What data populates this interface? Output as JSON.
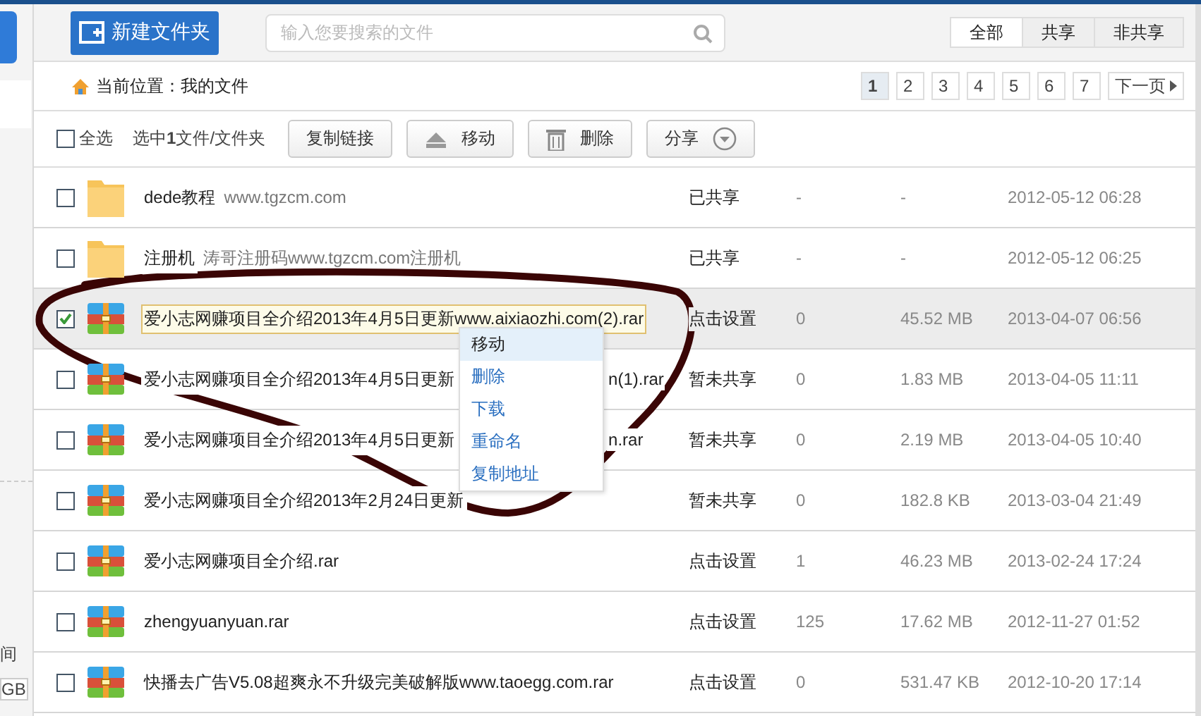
{
  "sidebar": {
    "texts": [
      "间",
      "GB"
    ]
  },
  "toolbar": {
    "new_folder": "新建文件夹",
    "search": {
      "placeholder": "输入您要搜索的文件"
    },
    "filters": [
      {
        "label": "全部",
        "selected": true
      },
      {
        "label": "共享",
        "selected": false
      },
      {
        "label": "非共享",
        "selected": false
      }
    ]
  },
  "breadcrumb": {
    "label": "当前位置：我的文件"
  },
  "pagination": {
    "pages": [
      {
        "label": "1",
        "selected": true
      },
      {
        "label": "2",
        "selected": false
      },
      {
        "label": "3",
        "selected": false
      },
      {
        "label": "4",
        "selected": false
      },
      {
        "label": "5",
        "selected": false
      },
      {
        "label": "6",
        "selected": false
      },
      {
        "label": "7",
        "selected": false
      }
    ],
    "next": "下一页"
  },
  "actions": {
    "select_all": {
      "label": "全选",
      "checked": false
    },
    "selection_info": "选中**1**文件/文件夹",
    "buttons": [
      {
        "label": "复制链接"
      },
      {
        "label": "移动"
      },
      {
        "label": "删除"
      },
      {
        "label": "分享"
      }
    ]
  },
  "files": [
    {
      "kind": "folder",
      "checked": false,
      "selected": false,
      "name": "dede教程",
      "note": "www.tgzcm.com",
      "share": "已共享",
      "count": "-",
      "size": "-",
      "date": "2012-05-12 06:28"
    },
    {
      "kind": "folder",
      "checked": false,
      "selected": false,
      "name": "注册机",
      "note": "涛哥注册码www.tgzcm.com注册机",
      "share": "已共享",
      "count": "-",
      "size": "-",
      "date": "2012-05-12 06:25"
    },
    {
      "kind": "archive",
      "checked": true,
      "selected": true,
      "name": "爱小志网赚项目全介绍2013年4月5日更新www.aixiaozhi.com(2).rar",
      "share": "点击设置",
      "count": "0",
      "size": "45.52 MB",
      "date": "2013-04-07 06:56"
    },
    {
      "kind": "archive",
      "checked": false,
      "selected": false,
      "name": "爱小志网赚项目全介绍2013年4月5日更新",
      "name_tail": "n(1).rar",
      "share": "暂未共享",
      "count": "0",
      "size": "1.83 MB",
      "date": "2013-04-05 11:11"
    },
    {
      "kind": "archive",
      "checked": false,
      "selected": false,
      "name": "爱小志网赚项目全介绍2013年4月5日更新",
      "name_tail": "n.rar",
      "share": "暂未共享",
      "count": "0",
      "size": "2.19 MB",
      "date": "2013-04-05 10:40"
    },
    {
      "kind": "archive",
      "checked": false,
      "selected": false,
      "name": "爱小志网赚项目全介绍2013年2月24日更新",
      "share": "暂未共享",
      "count": "0",
      "size": "182.8 KB",
      "date": "2013-03-04 21:49"
    },
    {
      "kind": "archive",
      "checked": false,
      "selected": false,
      "name": "爱小志网赚项目全介绍.rar",
      "share": "点击设置",
      "count": "1",
      "size": "46.23 MB",
      "date": "2013-02-24 17:24"
    },
    {
      "kind": "archive",
      "checked": false,
      "selected": false,
      "name": "zhengyuanyuan.rar",
      "share": "点击设置",
      "count": "125",
      "size": "17.62 MB",
      "date": "2012-11-27 01:52"
    },
    {
      "kind": "archive",
      "checked": false,
      "selected": false,
      "name": "快播去广告V5.08超爽永不升级完美破解版www.taoegg.com.rar",
      "share": "点击设置",
      "count": "0",
      "size": "531.47 KB",
      "date": "2012-10-20 17:14"
    }
  ],
  "context_menu": [
    {
      "label": "移动",
      "highlighted": true
    },
    {
      "label": "删除",
      "highlighted": false
    },
    {
      "label": "下载",
      "highlighted": false
    },
    {
      "label": "重命名",
      "highlighted": false
    },
    {
      "label": "复制地址",
      "highlighted": false
    }
  ],
  "annotation": {
    "kind": "ellipse"
  }
}
